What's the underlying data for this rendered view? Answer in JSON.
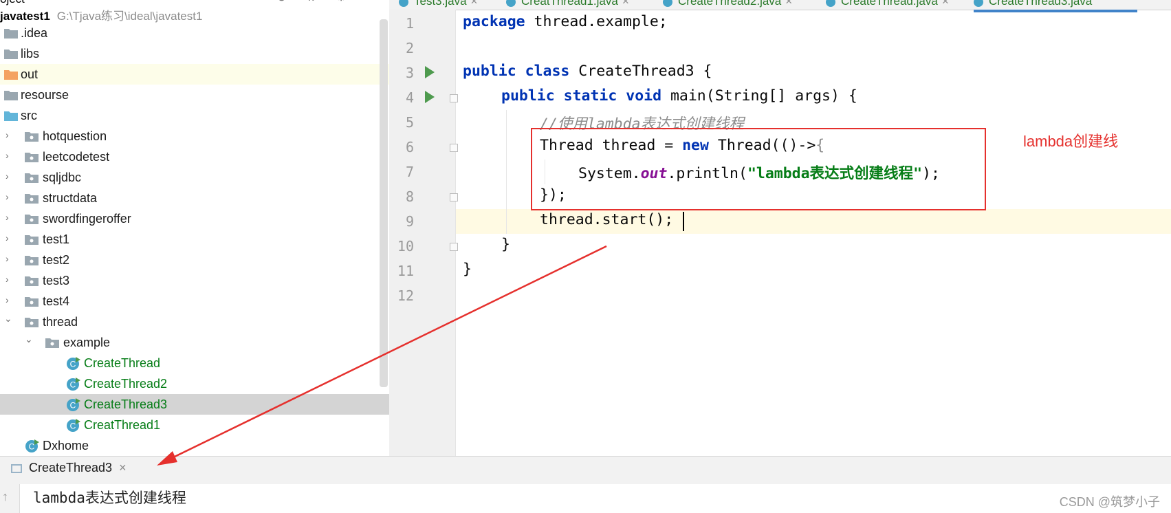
{
  "project_panel": {
    "header_title": "oject",
    "root_name": "javatest1",
    "root_path": "G:\\Tjava练习\\ideal\\javatest1",
    "items": [
      {
        "label": "out",
        "kind": "folder-orange"
      }
    ],
    "folders_top": [
      ".idea",
      "libs",
      "out",
      "resourse",
      "src"
    ],
    "packages": [
      "hotquestion",
      "leetcodetest",
      "sqljdbc",
      "structdata",
      "swordfingeroffer",
      "test1",
      "test2",
      "test3",
      "test4",
      "thread"
    ],
    "subpackage": "example",
    "classes": [
      "CreateThread",
      "CreateThread2",
      "CreateThread3",
      "CreatThread1"
    ],
    "other_class": "Dxhome"
  },
  "editor": {
    "tabs": [
      "Test3.java",
      "CreatThread1.java",
      "CreateThread2.java",
      "CreateThread.java",
      "CreateThread3.java"
    ],
    "active_tab": "CreateThread3.java",
    "line_numbers": [
      "1",
      "2",
      "3",
      "4",
      "5",
      "6",
      "7",
      "8",
      "9",
      "10",
      "11",
      "12"
    ],
    "code": {
      "l1_kw": "package",
      "l1_rest": " thread.example;",
      "l3_kw1": "public",
      "l3_kw2": "class",
      "l3_rest": " CreateThread3 {",
      "l4_kw1": "public",
      "l4_kw2": "static",
      "l4_kw3": "void",
      "l4_rest": " main(String[] args) {",
      "l5_comment": "//使用lambda表达式创建线程",
      "l6_a": "Thread thread = ",
      "l6_kw": "new",
      "l6_b": " Thread(()->",
      "l6_brace": "{",
      "l7_a": "System.",
      "l7_field": "out",
      "l7_b": ".println(",
      "l7_str": "\"lambda表达式创建线程\"",
      "l7_c": ");",
      "l8": "});",
      "l9": "thread.start();",
      "l10": "}",
      "l11": "}"
    },
    "annotation": "lambda创建线"
  },
  "run_panel": {
    "tab_label": "CreateThread3",
    "close_glyph": "×",
    "output_line": "lambda表达式创建线程",
    "watermark": "CSDN @筑梦小子"
  },
  "colors": {
    "keyword": "#0033b3",
    "string": "#067d17",
    "comment": "#8c8c8c",
    "annotation_red": "#e5302d"
  }
}
